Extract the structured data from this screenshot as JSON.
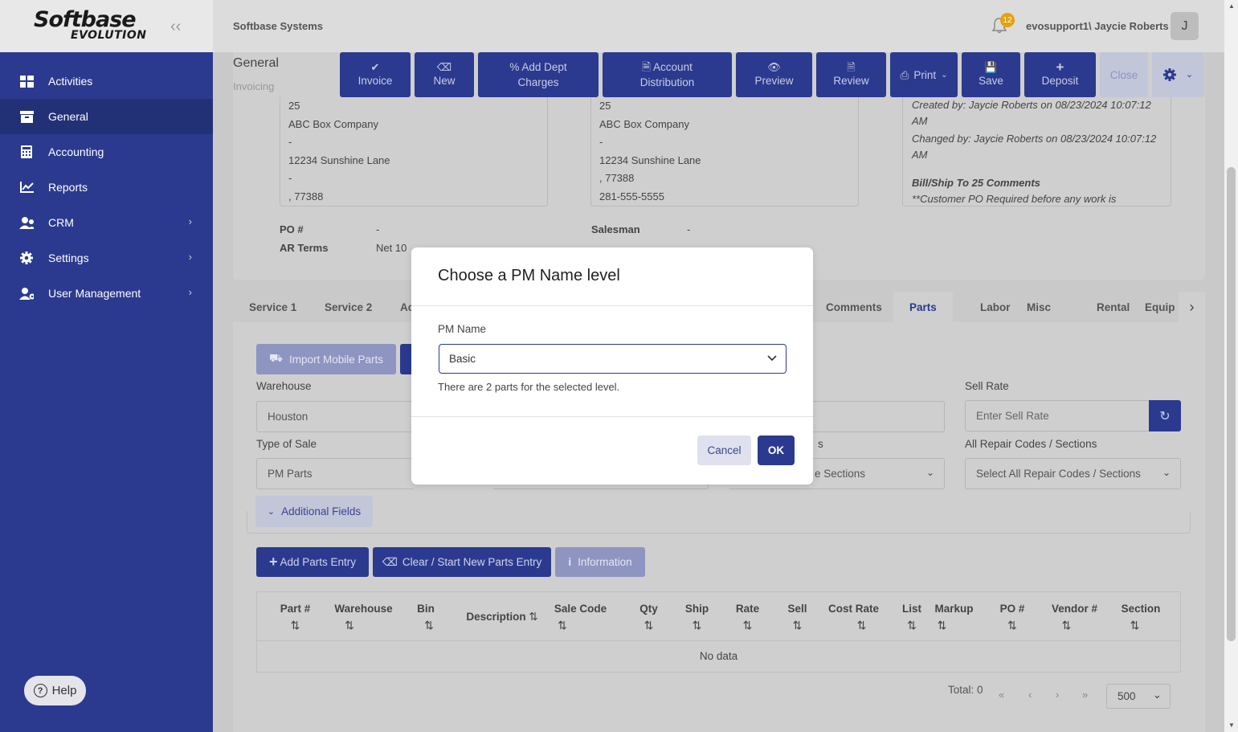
{
  "brand": {
    "line1": "Softbase",
    "line2": "EVOLUTION"
  },
  "sidebar": {
    "items": [
      {
        "label": "Activities"
      },
      {
        "label": "General"
      },
      {
        "label": "Accounting"
      },
      {
        "label": "Reports"
      },
      {
        "label": "CRM"
      },
      {
        "label": "Settings"
      },
      {
        "label": "User Management"
      }
    ],
    "help_label": "Help"
  },
  "topbar": {
    "company": "Softbase Systems",
    "notifications": "12",
    "user": "evosupport1\\ Jaycie Roberts",
    "avatar": "J"
  },
  "page": {
    "title": "General",
    "subtitle": "Invoicing"
  },
  "toolbar": {
    "invoice": "Invoice",
    "new": "New",
    "add_dept_1": "Add Dept",
    "add_dept_2": "Charges",
    "account_1": "Account",
    "account_2": "Distribution",
    "preview": "Preview",
    "review": "Review",
    "print": "Print",
    "save": "Save",
    "deposit": "Deposit",
    "close": "Close"
  },
  "bill_to": [
    "25",
    "ABC Box Company",
    "-",
    "12234 Sunshine Lane",
    "-",
    ", 77388"
  ],
  "ship_to": [
    "25",
    "ABC Box Company",
    "-",
    "12234 Sunshine Lane",
    ", 77388",
    "281-555-5555"
  ],
  "meta": {
    "created": "Created by: Jaycie Roberts on 08/23/2024 10:07:12 AM",
    "changed": "Changed by: Jaycie Roberts on 08/23/2024 10:07:12 AM",
    "comments_title": "Bill/Ship To 25 Comments",
    "comments": "**Customer PO Required before any work is"
  },
  "fields": {
    "po_label": "PO #",
    "po_value": "-",
    "terms_label": "AR Terms",
    "terms_value": "Net 10",
    "salesman_label": "Salesman",
    "salesman_value": "-"
  },
  "tabs": [
    "Service 1",
    "Service 2",
    "Ac",
    "Comments",
    "Parts",
    "Labor",
    "Misc",
    "Rental",
    "Equip"
  ],
  "parts": {
    "import_mobile": "Import Mobile Parts",
    "warehouse_label": "Warehouse",
    "warehouse_value": "Houston",
    "type_of_sale_label": "Type of Sale",
    "type_of_sale_value": "PM Parts",
    "sell_rate_label": "Sell Rate",
    "sell_rate_placeholder": "Enter Sell Rate",
    "repair_codes_label": "All Repair Codes / Sections",
    "repair_codes_value": "Select All Repair Codes / Sections",
    "sections_partial": "e Sections",
    "additional_fields": "Additional Fields",
    "add_entry": "Add Parts Entry",
    "clear_entry": "Clear / Start New Parts Entry",
    "information": "Information"
  },
  "table": {
    "columns": [
      "Part #",
      "Warehouse",
      "Bin",
      "Description",
      "Sale Code",
      "Qty",
      "Ship",
      "Rate",
      "Sell",
      "Cost Rate",
      "List",
      "Markup",
      "PO #",
      "Vendor #",
      "Section"
    ],
    "sort_glyph": "⇅",
    "empty_text": "No data",
    "total": "Total: 0",
    "page_size": "500"
  },
  "modal": {
    "title": "Choose a PM Name level",
    "label": "PM Name",
    "selected": "Basic",
    "hint": "There are 2 parts for the selected level.",
    "cancel": "Cancel",
    "ok": "OK"
  }
}
